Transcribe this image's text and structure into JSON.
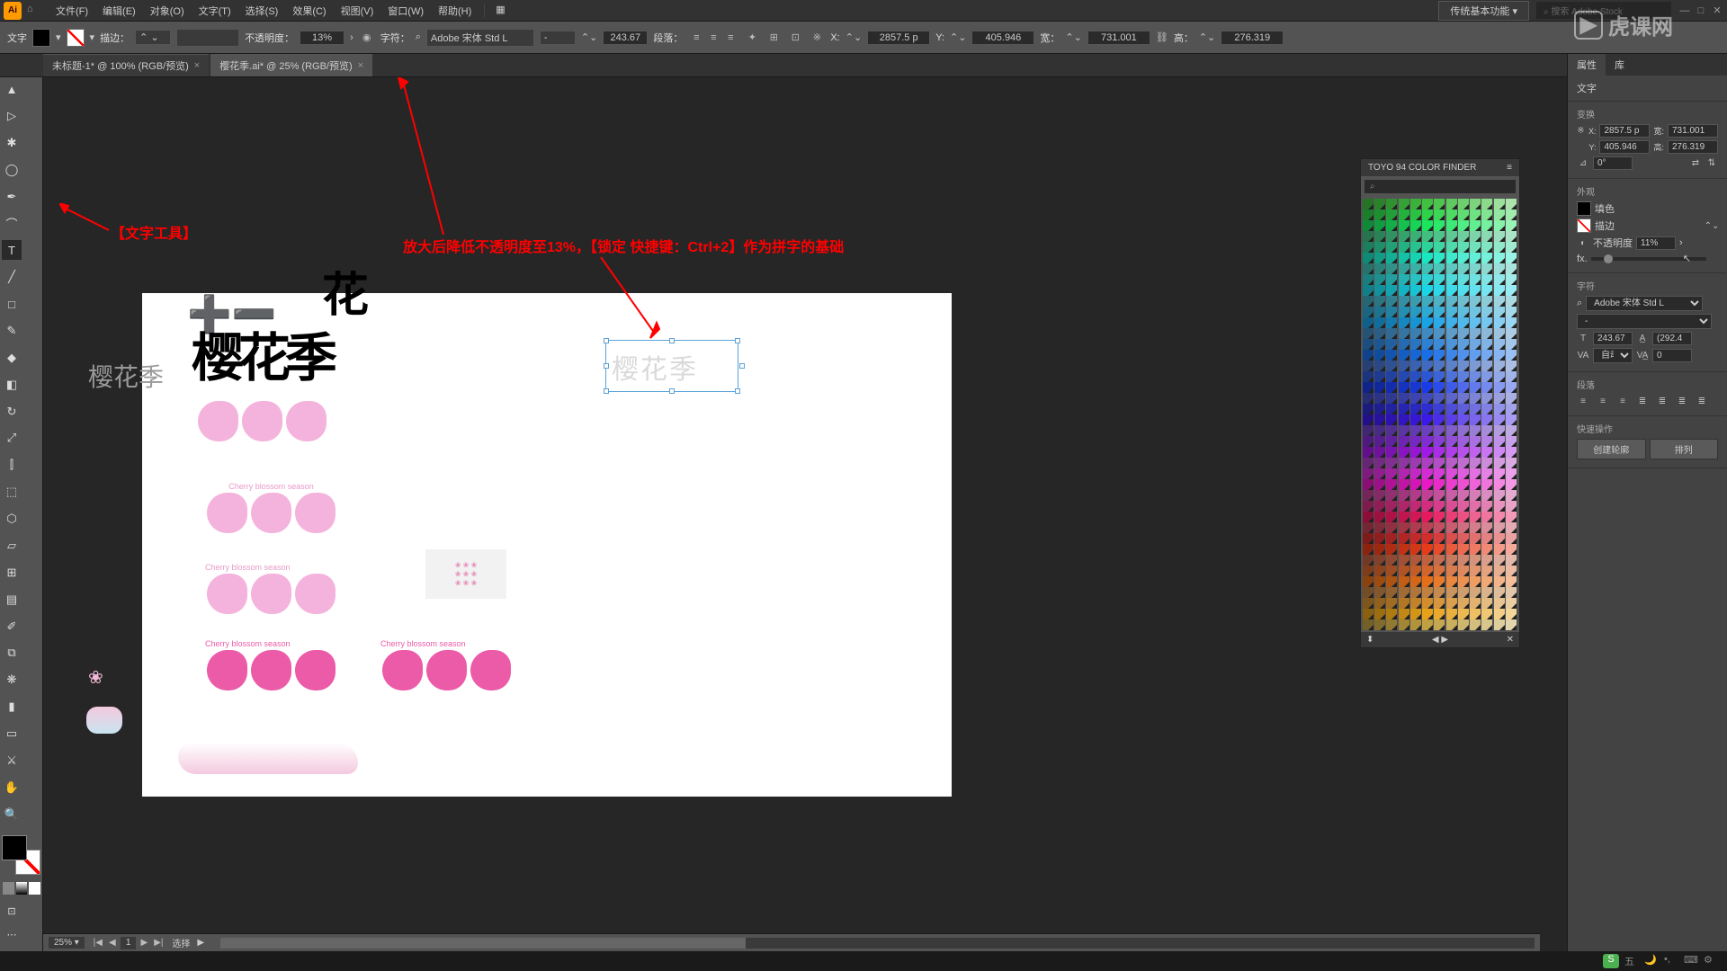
{
  "menubar": {
    "items": [
      "文件(F)",
      "编辑(E)",
      "对象(O)",
      "文字(T)",
      "选择(S)",
      "效果(C)",
      "视图(V)",
      "窗口(W)",
      "帮助(H)"
    ],
    "workspace": "传统基本功能",
    "search_placeholder": "搜索 Adobe Stock"
  },
  "optbar": {
    "tool_label": "文字",
    "stroke_label": "描边：",
    "opacity_label": "不透明度：",
    "opacity_value": "13%",
    "char_label": "字符：",
    "font": "Adobe 宋体 Std L",
    "font_style": "-",
    "font_size": "243.67",
    "para_label": "段落：",
    "x_label": "X:",
    "x_val": "2857.5 p",
    "y_label": "Y:",
    "y_val": "405.946",
    "w_label": "宽：",
    "w_val": "731.001",
    "h_label": "高：",
    "h_val": "276.319"
  },
  "tabs": [
    {
      "label": "未标题-1* @ 100% (RGB/预览)",
      "active": false
    },
    {
      "label": "樱花季.ai* @ 25% (RGB/预览)",
      "active": true
    }
  ],
  "canvas": {
    "gray_text": "樱花季",
    "sel_text": "樱花季",
    "anno1": "【文字工具】",
    "anno2": "放大后降低不透明度至13%，【锁定 快捷键：Ctrl+2】作为拼字的基础",
    "cherry_en": "Cherry blossom season"
  },
  "color_panel": {
    "title": "TOYO 94 COLOR FINDER",
    "search_icon": "⌕"
  },
  "prop_panel": {
    "tab1": "属性",
    "tab2": "库",
    "obj_type": "文字",
    "sect_transform": "变换",
    "x": "2857.5 p",
    "w": "731.001",
    "y": "405.946",
    "h": "276.319",
    "rot": "0°",
    "sect_appearance": "外观",
    "fill_label": "填色",
    "stroke_label": "描边",
    "opacity_label": "不透明度",
    "opacity_val": "11%",
    "fx_label": "fx.",
    "sect_char": "字符",
    "font": "Adobe 宋体 Std L",
    "font_style": "-",
    "font_size": "243.67",
    "leading": "(292.4",
    "kerning": "自动",
    "tracking": "0",
    "sect_para": "段落",
    "sect_quick": "快速操作",
    "btn_outline": "创建轮廓",
    "btn_arrange": "排列"
  },
  "statusbar": {
    "zoom": "25%",
    "page": "1",
    "tool": "选择"
  },
  "watermark": "虎课网",
  "chart_data": null
}
